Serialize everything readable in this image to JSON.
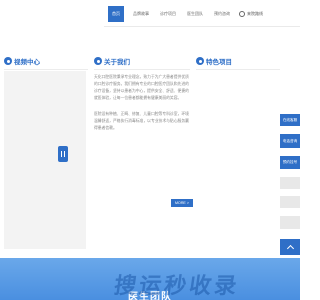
{
  "nav": {
    "items": [
      "首页",
      "品牌故事",
      "诊疗项目",
      "医生团队",
      "预约咨询"
    ],
    "active_index": 0,
    "search_label": "来院路线"
  },
  "sections": {
    "video": {
      "title": "视频中心"
    },
    "about": {
      "title": "关于我们",
      "paragraph1": "天化口腔医院秉承专业理念，致力于为广大患者提供优质的口腔诊疗服务。我们拥有专业的口腔医疗团队和先进的诊疗设备，坚持以患者为中心，提供安全、舒适、便捷的就医体验，让每一位患者都能拥有健康美丽的笑容。",
      "paragraph2": "医院设有种植、正畸、修复、儿童口腔等专科诊室，环境温馨舒适，严格执行消毒标准，以专业技术与贴心服务赢得患者信赖。",
      "more_button": "MORE >"
    },
    "projects": {
      "title": "特色项目"
    }
  },
  "side_widget": {
    "items": [
      "在线客服",
      "电话咨询",
      "预约挂号"
    ]
  },
  "banner": {
    "title": "医生团队",
    "watermark": "搜运秒收录"
  },
  "colors": {
    "primary": "#2f6fc7",
    "banner": "#5a9be6"
  }
}
